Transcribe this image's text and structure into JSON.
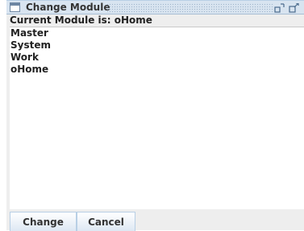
{
  "window": {
    "title": "Change Module",
    "icons": {
      "window": "window-icon",
      "restore": "restore-icon",
      "maximize": "maximize-icon"
    }
  },
  "header": {
    "current_label": "Current Module is:  oHome"
  },
  "modules": [
    "Master",
    "System",
    "Work",
    "oHome"
  ],
  "buttons": {
    "change_label": "Change",
    "cancel_label": "Cancel"
  },
  "colors": {
    "titlebar": "#d8e4f0",
    "accent": "#b8cfe5",
    "background": "#eeeeee"
  }
}
